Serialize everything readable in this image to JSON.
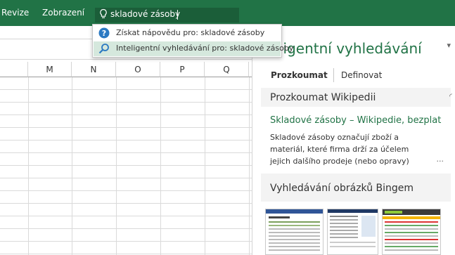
{
  "colors": {
    "ribbon": "#217346",
    "accent": "#217346",
    "selected_item_bg": "#d5e8dd"
  },
  "ribbon": {
    "tabs": [
      "Revize",
      "Zobrazení"
    ],
    "tell_me": {
      "icon": "lightbulb-icon",
      "value": "skladové zásoby"
    }
  },
  "dropdown": {
    "items": [
      {
        "icon": "help-question-icon",
        "label": "Získat nápovědu pro: skladové zásoby",
        "selected": false
      },
      {
        "icon": "smart-lookup-icon",
        "label": "Inteligentní vyhledávání pro: skladové zásoby",
        "selected": true
      }
    ]
  },
  "sheet": {
    "columns": [
      "M",
      "N",
      "O",
      "P",
      "Q"
    ]
  },
  "pane": {
    "title": "ligentní vyhledávání",
    "tabs": [
      "Prozkoumat",
      "Definovat"
    ],
    "wiki_section": "Prozkoumat Wikipedii",
    "result": {
      "title": "Skladové zásoby – Wikipedie, bezplat",
      "line1": "Skladové zásoby označují zboží a",
      "line2": "materiál, které firma drží za účelem",
      "line3": "jejich dalšího prodeje (nebo opravy)",
      "more": "..."
    },
    "images_section": "Vyhledávání obrázků Bingem"
  }
}
